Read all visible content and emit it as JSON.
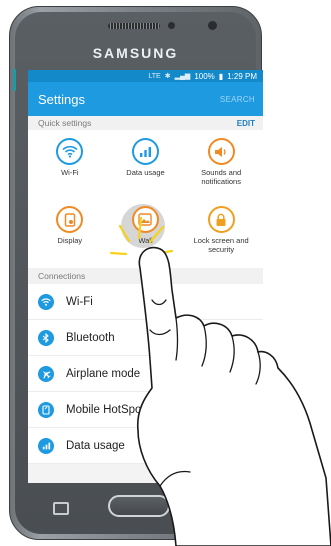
{
  "device": {
    "brand": "SAMSUNG"
  },
  "status_bar": {
    "network": "LTE",
    "battery": "100%",
    "time": "1:29 PM"
  },
  "app_bar": {
    "title": "Settings",
    "search": "SEARCH"
  },
  "quick_settings": {
    "header": "Quick settings",
    "edit": "EDIT",
    "tiles": [
      {
        "label": "Wi-Fi",
        "icon": "wifi-icon",
        "color": "#1e9ae0"
      },
      {
        "label": "Data usage",
        "icon": "data-usage-icon",
        "color": "#1e9ae0"
      },
      {
        "label": "Sounds and notifications",
        "icon": "volume-icon",
        "color": "#f08a24"
      },
      {
        "label": "Display",
        "icon": "display-icon",
        "color": "#f08a24"
      },
      {
        "label": "Wall",
        "icon": "wallpaper-icon",
        "color": "#f08a24"
      },
      {
        "label": "Lock screen and security",
        "icon": "lock-icon",
        "color": "#f0a020"
      }
    ]
  },
  "connections": {
    "header": "Connections",
    "items": [
      {
        "label": "Wi-Fi",
        "icon": "wifi-icon"
      },
      {
        "label": "Bluetooth",
        "icon": "bluetooth-icon"
      },
      {
        "label": "Airplane mode",
        "icon": "airplane-icon"
      },
      {
        "label": "Mobile HotSpot and T",
        "icon": "hotspot-icon"
      },
      {
        "label": "Data usage",
        "icon": "data-usage-icon"
      }
    ]
  },
  "colors": {
    "accent": "#1e9ae0",
    "status_bar": "#1489c9",
    "orange": "#f08a24",
    "tap_highlight": "#f7d21b"
  }
}
